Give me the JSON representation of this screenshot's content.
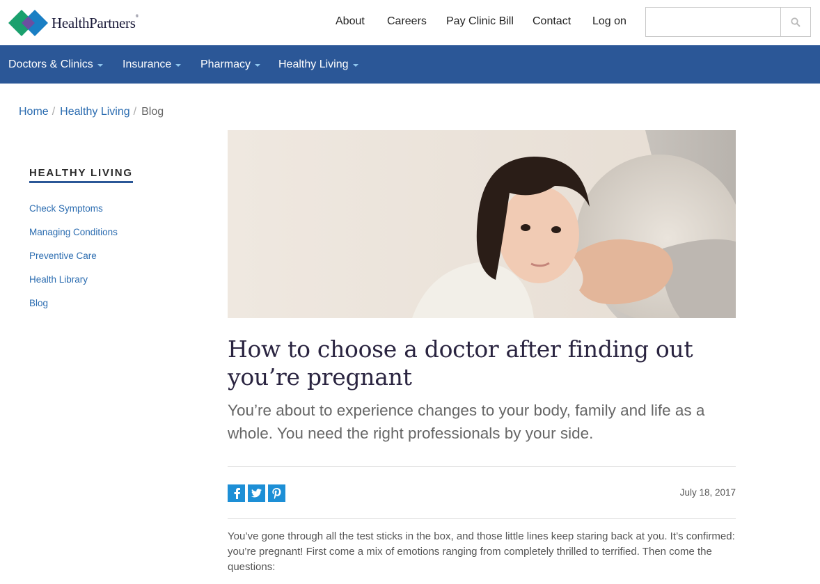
{
  "header": {
    "logo_text": "HealthPartners",
    "logo_mark": "®",
    "top_links": [
      "About",
      "Careers",
      "Pay Clinic Bill",
      "Contact",
      "Log on"
    ],
    "search": {
      "placeholder": "",
      "value": ""
    }
  },
  "nav": {
    "items": [
      {
        "label": "Doctors & Clinics",
        "has_dropdown": true
      },
      {
        "label": "Insurance",
        "has_dropdown": true
      },
      {
        "label": "Pharmacy",
        "has_dropdown": true
      },
      {
        "label": "Healthy Living",
        "has_dropdown": true
      }
    ],
    "color": "#2b5797"
  },
  "breadcrumb": {
    "items": [
      {
        "label": "Home",
        "link": true
      },
      {
        "label": "Healthy Living",
        "link": true
      },
      {
        "label": "Blog",
        "link": false
      }
    ]
  },
  "sidebar": {
    "heading": "HEALTHY LIVING",
    "links": [
      "Check Symptoms",
      "Managing Conditions",
      "Preventive Care",
      "Health Library",
      "Blog"
    ]
  },
  "article": {
    "title": "How to choose a doctor after finding out you’re pregnant",
    "subtitle": "You’re about to experience changes to your body, family and life as a whole. You need the right professionals by your side.",
    "date": "July 18, 2017",
    "share": [
      "facebook-icon",
      "twitter-icon",
      "pinterest-icon"
    ],
    "body": "You’ve gone through all the test sticks in the box, and those little lines keep staring back at you. It’s confirmed: you’re pregnant! First come a mix of emotions ranging from completely thrilled to terrified. Then come the questions:"
  },
  "colors": {
    "brand_blue": "#2b5797",
    "link_blue": "#2b6cb0",
    "share_blue": "#1d8fd6",
    "logo_green": "#1aa06d",
    "logo_purple": "#6b4fa0",
    "logo_teal": "#1a7fc4"
  }
}
